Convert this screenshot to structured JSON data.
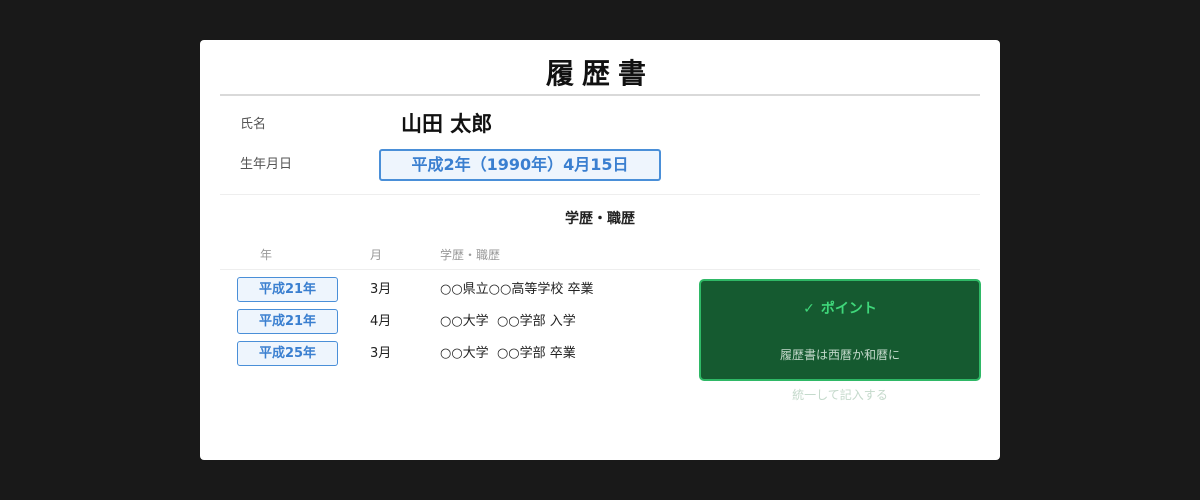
{
  "document": {
    "title": "履歴書"
  },
  "personal": {
    "name_label": "氏名",
    "name_value": "山田 太郎",
    "dob_label": "生年月日",
    "dob_value": "平成2年（1990年）4月15日"
  },
  "history": {
    "section_title": "学歴・職歴",
    "columns": [
      "年",
      "月",
      "学歴・職歴"
    ],
    "rows": [
      {
        "year": "平成21年",
        "month": "3月",
        "description": "○○県立○○高等学校 卒業"
      },
      {
        "year": "平成21年",
        "month": "4月",
        "description": "○○大学  ○○学部 入学"
      },
      {
        "year": "平成25年",
        "month": "3月",
        "description": "○○大学  ○○学部 卒業"
      }
    ]
  },
  "point": {
    "check": "✓",
    "title": "ポイント",
    "line1": "履歴書は西暦か和暦に",
    "line2": "統一して記入する"
  },
  "colors": {
    "background": "#191919",
    "card": "#ffffff",
    "accent_blue": "#4a8fd8",
    "point_green_bg": "#155a30",
    "point_green_border": "#2fb866",
    "point_green_text": "#3fd77a"
  }
}
